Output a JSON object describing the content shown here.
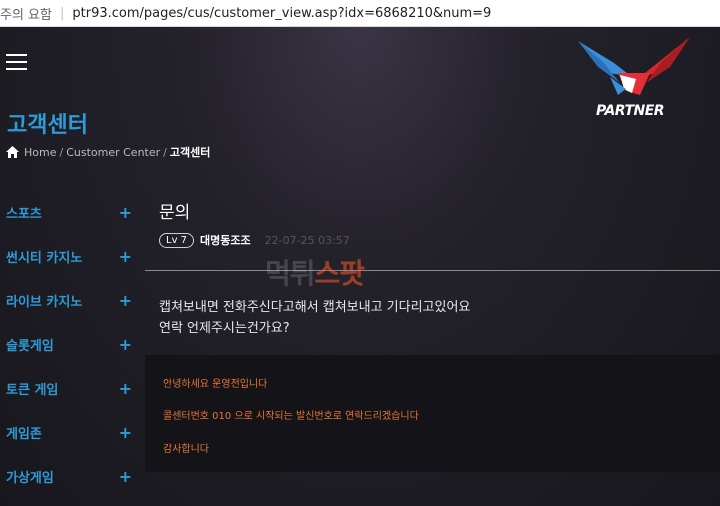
{
  "browser": {
    "security_label": "주의 요함",
    "url": "ptr93.com/pages/cus/customer_view.asp?idx=6868210&num=9"
  },
  "header": {
    "logo_text": "PARTNER",
    "page_title": "고객센터",
    "breadcrumb": {
      "home": "Home",
      "sep": "/",
      "customer_center": "Customer Center",
      "current": "고객센터"
    }
  },
  "sidebar": {
    "items": [
      {
        "label": "스포츠",
        "icon": "+"
      },
      {
        "label": "썬시티 카지노",
        "icon": "+"
      },
      {
        "label": "라이브 카지노",
        "icon": "+"
      },
      {
        "label": "슬롯게임",
        "icon": "+"
      },
      {
        "label": "토큰 게임",
        "icon": "+"
      },
      {
        "label": "게임존",
        "icon": "+"
      },
      {
        "label": "가상게임",
        "icon": "+"
      }
    ]
  },
  "post": {
    "title": "문의",
    "level_badge": "Lv 7",
    "author": "대명동조조",
    "date": "22-07-25 03:57",
    "body_lines": [
      "캡쳐보내면 전화주신다고해서 캡쳐보내고 기다리고있어요",
      "연락 언제주시는건가요?"
    ]
  },
  "reply": {
    "lines": [
      "안녕하세요 운영전입니다",
      "콜센터번호 010 으로 시작되는 발신번호로 연락드리겠습니다",
      "감사합니다"
    ]
  },
  "watermark": {
    "text_main": "먹튀",
    "text_accent": "스팟"
  },
  "colors": {
    "accent_blue": "#2e9bd6",
    "reply_orange": "#e8743a",
    "page_bg": "#1c1b22"
  }
}
